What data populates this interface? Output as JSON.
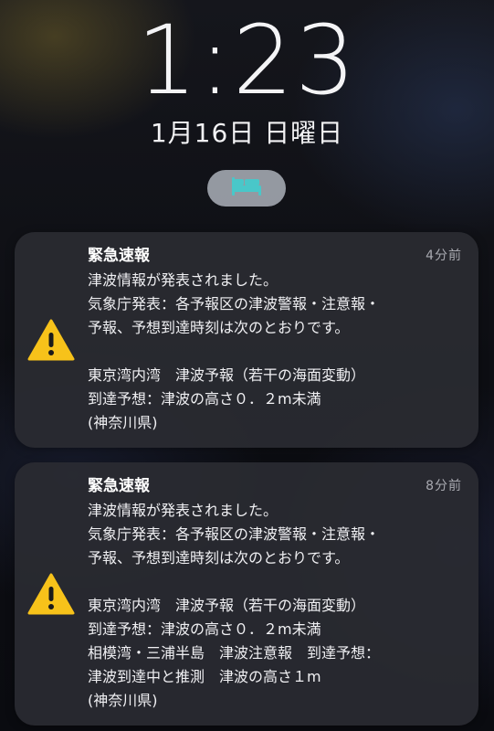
{
  "lockscreen": {
    "time": "1:23",
    "date": "1月16日 日曜日",
    "focus_mode_icon": "bed-icon"
  },
  "notifications": [
    {
      "icon": "warning-triangle-icon",
      "title": "緊急速報",
      "time_ago": "4分前",
      "lines": [
        "津波情報が発表されました。",
        "気象庁発表：各予報区の津波警報・注意報・",
        "予報、予想到達時刻は次のとおりです。",
        "",
        "東京湾内湾　津波予報（若干の海面変動）",
        "到達予想：津波の高さ０．２m未満",
        "(神奈川県)"
      ]
    },
    {
      "icon": "warning-triangle-icon",
      "title": "緊急速報",
      "time_ago": "8分前",
      "lines": [
        "津波情報が発表されました。",
        "気象庁発表：各予報区の津波警報・注意報・",
        "予報、予想到達時刻は次のとおりです。",
        "",
        "東京湾内湾　津波予報（若干の海面変動）",
        "到達予想：津波の高さ０．２m未満",
        "相模湾・三浦半島　津波注意報　到達予想：",
        "津波到達中と推測　津波の高さ１m",
        "(神奈川県)"
      ]
    }
  ],
  "colors": {
    "warning_yellow": "#f7c21a",
    "sleep_teal": "#49c7c9"
  }
}
